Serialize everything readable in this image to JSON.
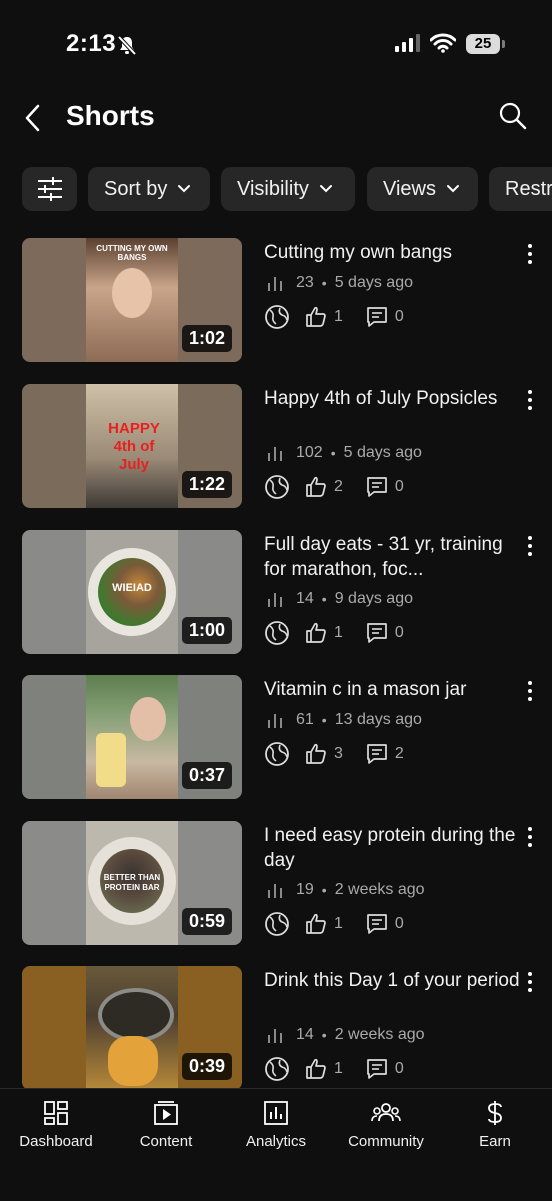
{
  "status_bar": {
    "time": "2:13",
    "battery": "25"
  },
  "header": {
    "title": "Shorts"
  },
  "filters": [
    {
      "label": "Sort by"
    },
    {
      "label": "Visibility"
    },
    {
      "label": "Views"
    },
    {
      "label": "Restr"
    }
  ],
  "videos": [
    {
      "title": "Cutting my own bangs",
      "duration": "1:02",
      "views": "23",
      "age": "5 days ago",
      "likes": "1",
      "comments": "0",
      "thumb_caption": "CUTTING MY OWN BANGS"
    },
    {
      "title": "Happy 4th of July Popsicles",
      "duration": "1:22",
      "views": "102",
      "age": "5 days ago",
      "likes": "2",
      "comments": "0",
      "thumb_caption": "HAPPY 4th of July"
    },
    {
      "title": "Full day eats - 31 yr, training for marathon, foc...",
      "duration": "1:00",
      "views": "14",
      "age": "9 days ago",
      "likes": "1",
      "comments": "0",
      "thumb_caption": "WIEIAD"
    },
    {
      "title": "Vitamin c in a mason jar",
      "duration": "0:37",
      "views": "61",
      "age": "13 days ago",
      "likes": "3",
      "comments": "2",
      "thumb_caption": ""
    },
    {
      "title": "I need easy protein during the day",
      "duration": "0:59",
      "views": "19",
      "age": "2 weeks ago",
      "likes": "1",
      "comments": "0",
      "thumb_caption": "BETTER THAN PROTEIN BAR"
    },
    {
      "title": "Drink this Day 1 of your period",
      "duration": "0:39",
      "views": "14",
      "age": "2 weeks ago",
      "likes": "1",
      "comments": "0",
      "thumb_caption": ""
    }
  ],
  "bottom_nav": [
    {
      "label": "Dashboard",
      "icon": "dashboard-icon"
    },
    {
      "label": "Content",
      "icon": "content-icon"
    },
    {
      "label": "Analytics",
      "icon": "analytics-icon"
    },
    {
      "label": "Community",
      "icon": "community-icon"
    },
    {
      "label": "Earn",
      "icon": "earn-icon"
    }
  ],
  "colors": {
    "background": "#0f0f0f",
    "chip": "#272727",
    "meta_text": "#aaaaaa"
  }
}
